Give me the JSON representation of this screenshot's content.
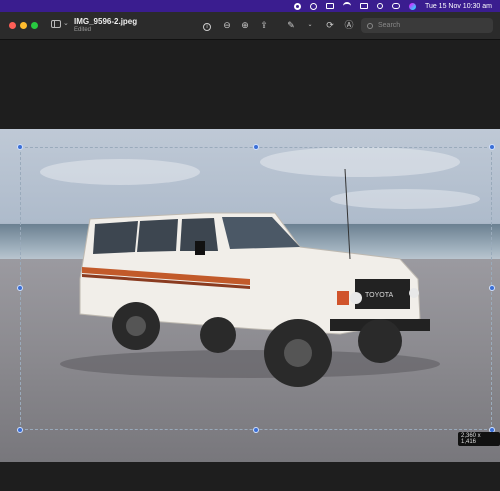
{
  "menubar": {
    "date_time": "Tue 15 Nov  10:30 am",
    "icons": [
      "screen-record-icon",
      "play-icon",
      "display-icon",
      "wifi-icon",
      "keyboard-icon",
      "search-icon",
      "control-center-icon",
      "siri-icon"
    ]
  },
  "toolbar": {
    "title": "IMG_9596-2.jpeg",
    "subtitle": "Edited",
    "search_placeholder": "Search",
    "icons": [
      "info-icon",
      "zoom-out-icon",
      "zoom-in-icon",
      "share-icon",
      "markup-icon",
      "rotate-icon",
      "annotate-icon"
    ]
  },
  "selection": {
    "dimensions": "2,360 x 1,416"
  },
  "colors": {
    "menubar": "#3a1d8f",
    "toolbar": "#2b2b2b",
    "canvas": "#1e1e1e",
    "handle": "#3b6fd6"
  }
}
